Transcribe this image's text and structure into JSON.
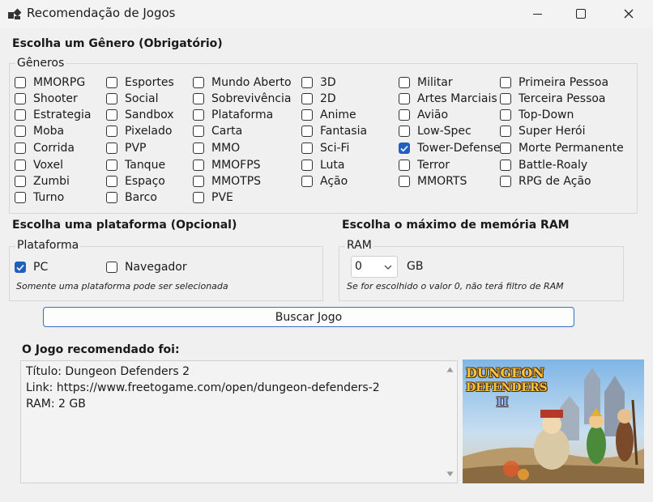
{
  "window": {
    "title": "Recomendação de Jogos"
  },
  "genre_section": {
    "heading": "Escolha um Gênero (Obrigatório)",
    "legend": "Gêneros",
    "columns": [
      [
        {
          "label": "MMORPG",
          "checked": false
        },
        {
          "label": "Shooter",
          "checked": false
        },
        {
          "label": "Estrategia",
          "checked": false
        },
        {
          "label": "Moba",
          "checked": false
        },
        {
          "label": "Corrida",
          "checked": false
        },
        {
          "label": "Voxel",
          "checked": false
        },
        {
          "label": "Zumbi",
          "checked": false
        },
        {
          "label": "Turno",
          "checked": false
        }
      ],
      [
        {
          "label": "Esportes",
          "checked": false
        },
        {
          "label": "Social",
          "checked": false
        },
        {
          "label": "Sandbox",
          "checked": false
        },
        {
          "label": "Pixelado",
          "checked": false
        },
        {
          "label": "PVP",
          "checked": false
        },
        {
          "label": "Tanque",
          "checked": false
        },
        {
          "label": "Espaço",
          "checked": false
        },
        {
          "label": "Barco",
          "checked": false
        }
      ],
      [
        {
          "label": "Mundo Aberto",
          "checked": false
        },
        {
          "label": "Sobrevivência",
          "checked": false
        },
        {
          "label": "Plataforma",
          "checked": false
        },
        {
          "label": "Carta",
          "checked": false
        },
        {
          "label": "MMO",
          "checked": false
        },
        {
          "label": "MMOFPS",
          "checked": false
        },
        {
          "label": "MMOTPS",
          "checked": false
        },
        {
          "label": "PVE",
          "checked": false
        }
      ],
      [
        {
          "label": "3D",
          "checked": false
        },
        {
          "label": "2D",
          "checked": false
        },
        {
          "label": "Anime",
          "checked": false
        },
        {
          "label": "Fantasia",
          "checked": false
        },
        {
          "label": "Sci-Fi",
          "checked": false
        },
        {
          "label": "Luta",
          "checked": false
        },
        {
          "label": "Ação",
          "checked": false
        }
      ],
      [
        {
          "label": "Militar",
          "checked": false
        },
        {
          "label": "Artes Marciais",
          "checked": false
        },
        {
          "label": "Avião",
          "checked": false
        },
        {
          "label": "Low-Spec",
          "checked": false
        },
        {
          "label": "Tower-Defense",
          "checked": true
        },
        {
          "label": "Terror",
          "checked": false
        },
        {
          "label": "MMORTS",
          "checked": false
        }
      ],
      [
        {
          "label": "Primeira Pessoa",
          "checked": false
        },
        {
          "label": "Terceira Pessoa",
          "checked": false
        },
        {
          "label": "Top-Down",
          "checked": false
        },
        {
          "label": "Super Herói",
          "checked": false
        },
        {
          "label": "Morte Permanente",
          "checked": false
        },
        {
          "label": "Battle-Roaly",
          "checked": false
        },
        {
          "label": "RPG de Ação",
          "checked": false
        }
      ]
    ]
  },
  "platform_section": {
    "heading": "Escolha uma plataforma (Opcional)",
    "legend": "Plataforma",
    "options": [
      {
        "label": "PC",
        "checked": true
      },
      {
        "label": "Navegador",
        "checked": false
      }
    ],
    "hint": "Somente uma plataforma pode ser selecionada"
  },
  "ram_section": {
    "heading": "Escolha o máximo de memória RAM",
    "legend": "RAM",
    "selected": "0",
    "unit": "GB",
    "hint": "Se for escolhido o valor 0, não terá filtro de RAM"
  },
  "search_button": "Buscar Jogo",
  "result": {
    "heading": "O Jogo recomendado foi:",
    "lines": [
      "Título: Dungeon Defenders 2",
      "Link: https://www.freetogame.com/open/dungeon-defenders-2",
      "RAM: 2 GB"
    ]
  },
  "game_image": {
    "logo_line1": "DUNGEON",
    "logo_line2": "DEFENDERS",
    "logo_numeral": "II"
  },
  "colors": {
    "accent": "#1f5fbf",
    "button_border": "#2f6fc8"
  }
}
